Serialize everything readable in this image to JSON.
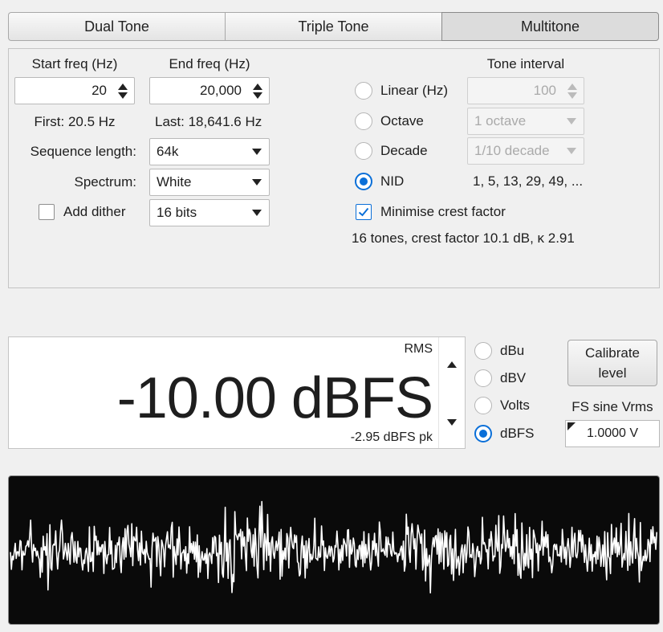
{
  "tabs": [
    {
      "label": "Dual Tone",
      "active": false
    },
    {
      "label": "Triple Tone",
      "active": false
    },
    {
      "label": "Multitone",
      "active": true
    }
  ],
  "settings": {
    "start_freq": {
      "label": "Start freq (Hz)",
      "value": "20"
    },
    "end_freq": {
      "label": "End freq (Hz)",
      "value": "20,000"
    },
    "first": "First: 20.5 Hz",
    "last": "Last: 18,641.6 Hz",
    "sequence_length": {
      "label": "Sequence length:",
      "value": "64k"
    },
    "spectrum": {
      "label": "Spectrum:",
      "value": "White"
    },
    "dither": {
      "label": "Add dither",
      "checked": false,
      "value": "16 bits"
    },
    "tone_interval": {
      "label": "Tone interval",
      "options": [
        {
          "label": "Linear (Hz)",
          "selected": false,
          "field": "100"
        },
        {
          "label": "Octave",
          "selected": false,
          "field": "1 octave"
        },
        {
          "label": "Decade",
          "selected": false,
          "field": "1/10 decade"
        },
        {
          "label": "NID",
          "selected": true,
          "field": "1, 5, 13, 29, 49, ..."
        }
      ]
    },
    "minimise_crest": {
      "label": "Minimise crest factor",
      "checked": true
    },
    "summary": "16 tones, crest factor 10.1 dB, κ 2.91"
  },
  "level": {
    "rms_label": "RMS",
    "value": "-10.00 dBFS",
    "peak": "-2.95 dBFS pk",
    "units": [
      {
        "label": "dBu",
        "selected": false
      },
      {
        "label": "dBV",
        "selected": false
      },
      {
        "label": "Volts",
        "selected": false
      },
      {
        "label": "dBFS",
        "selected": true
      }
    ],
    "calibrate_line1": "Calibrate",
    "calibrate_line2": "level",
    "fs_label": "FS sine Vrms",
    "fs_value": "1.0000 V"
  },
  "colors": {
    "accent": "#0a6fd8",
    "wave_bg": "#0a0a0a",
    "wave_line": "#ffffff"
  },
  "icons": {
    "spin": "up-down-arrows",
    "combo": "chevron-down",
    "check": "checkmark"
  }
}
